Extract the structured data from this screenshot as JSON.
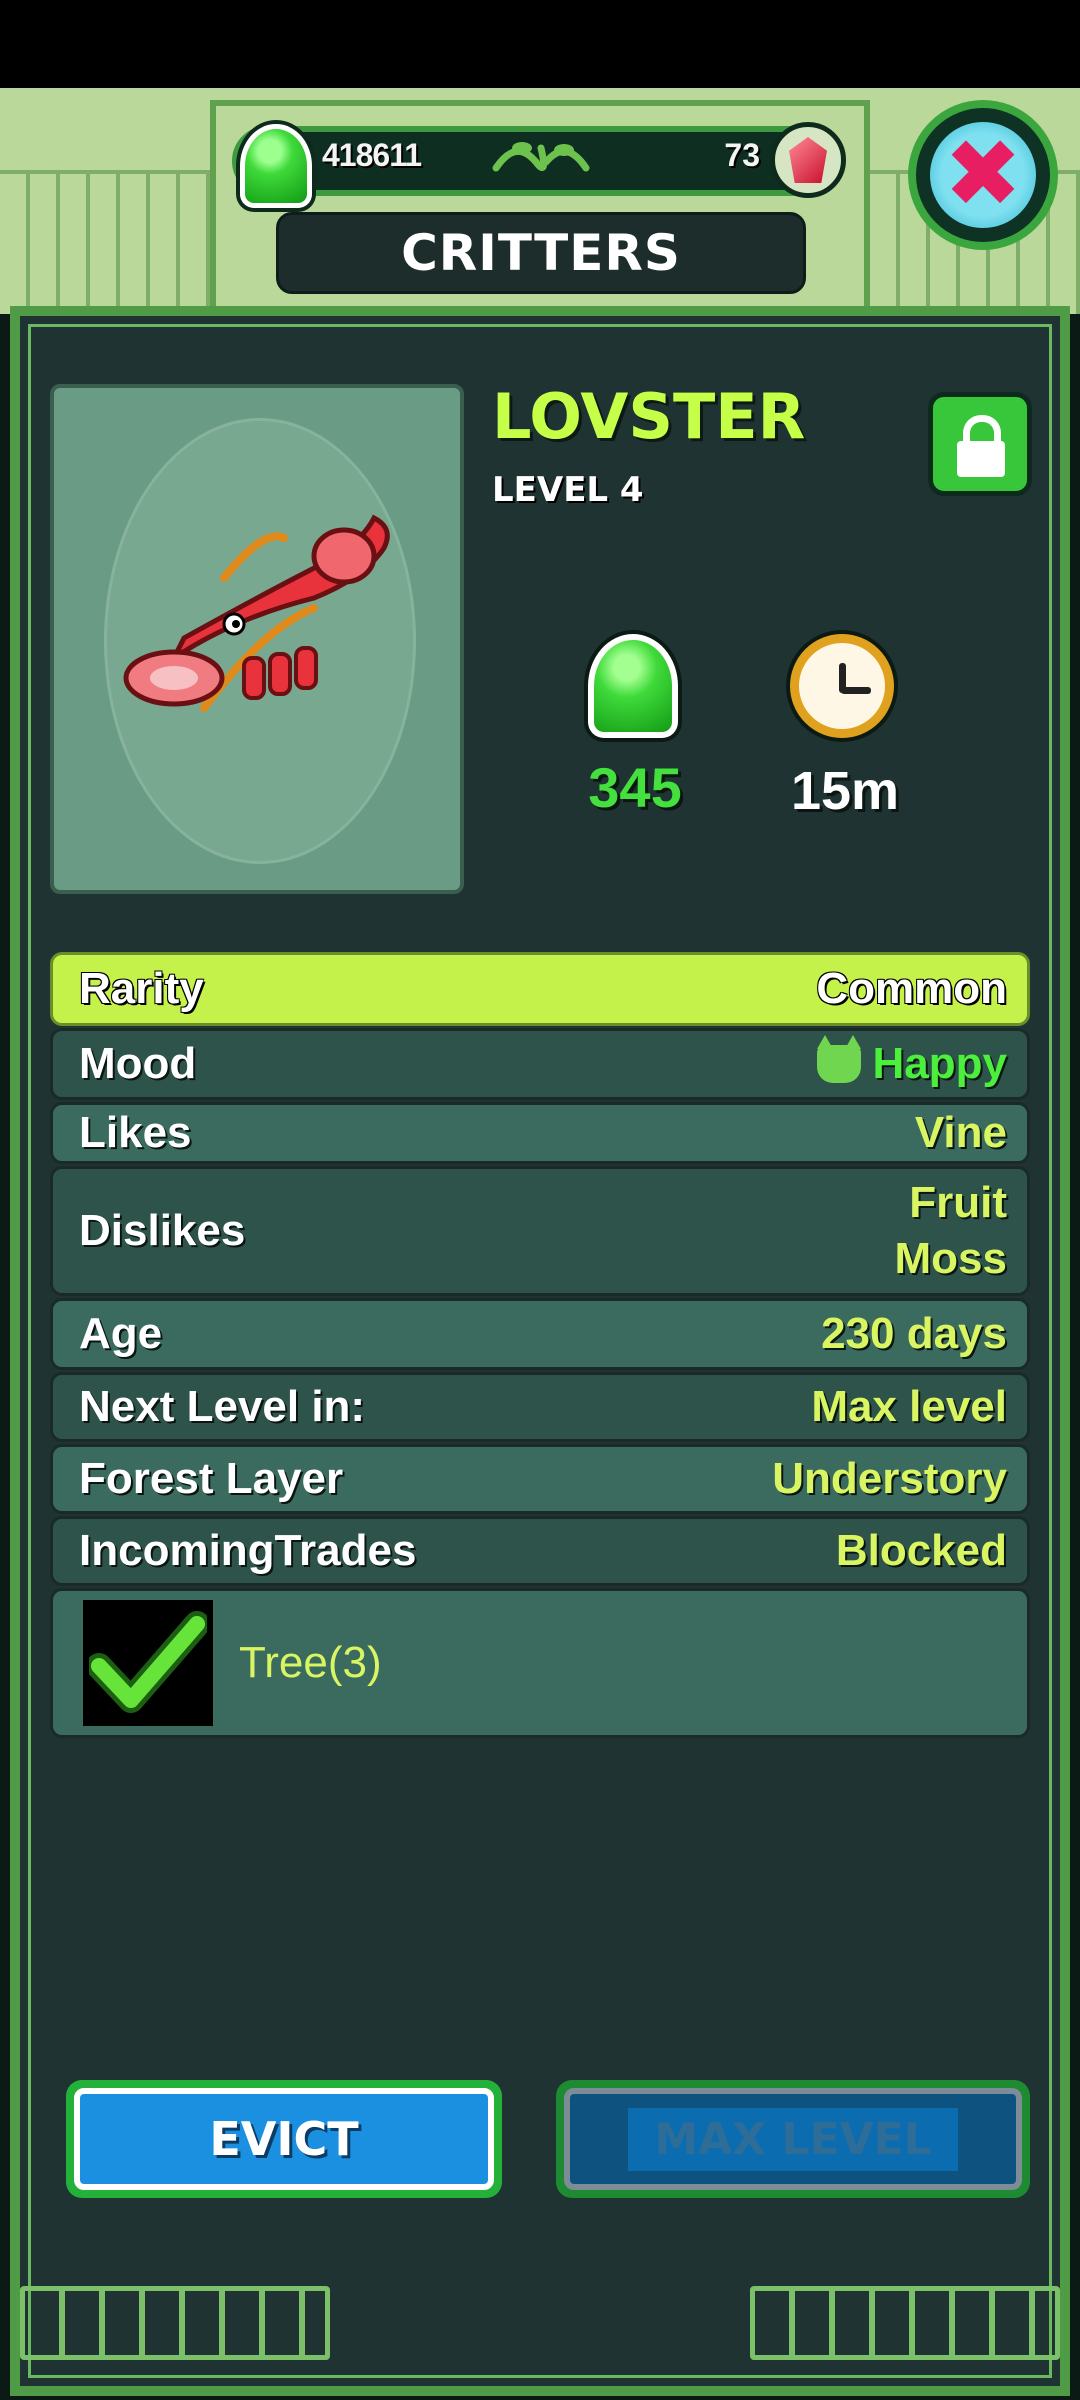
{
  "header": {
    "coins": "418611",
    "gems": "73",
    "title": "CRITTERS"
  },
  "critter": {
    "name": "LOVSTER",
    "level": "LEVEL 4",
    "production_value": "345",
    "production_time": "15m"
  },
  "details": [
    {
      "label": "Rarity",
      "value": "Common"
    },
    {
      "label": "Mood",
      "value": "Happy"
    },
    {
      "label": "Likes",
      "value": "Vine"
    },
    {
      "label": "Dislikes",
      "value_lines": [
        "Fruit",
        "Moss"
      ]
    },
    {
      "label": "Age",
      "value": "230 days"
    },
    {
      "label": "Next Level in:",
      "value": "Max level"
    },
    {
      "label": "Forest Layer",
      "value": "Understory"
    },
    {
      "label": "IncomingTrades",
      "value": "Blocked"
    }
  ],
  "requirement": {
    "label": "Tree(3)",
    "met": true
  },
  "buttons": {
    "evict": "EVICT",
    "max_level": "MAX LEVEL"
  },
  "icons": {
    "currency": "green-gem-icon",
    "premium": "red-crystal-icon",
    "close": "close-x-icon",
    "lock": "lock-icon",
    "timer": "clock-icon",
    "mood": "cat-face-icon",
    "requirement_met": "checkmark-icon"
  },
  "colors": {
    "name_accent": "#c6ff48",
    "value_text": "#d9f562",
    "mood_happy": "#4cef3c",
    "panel_border": "#4f9b46"
  }
}
